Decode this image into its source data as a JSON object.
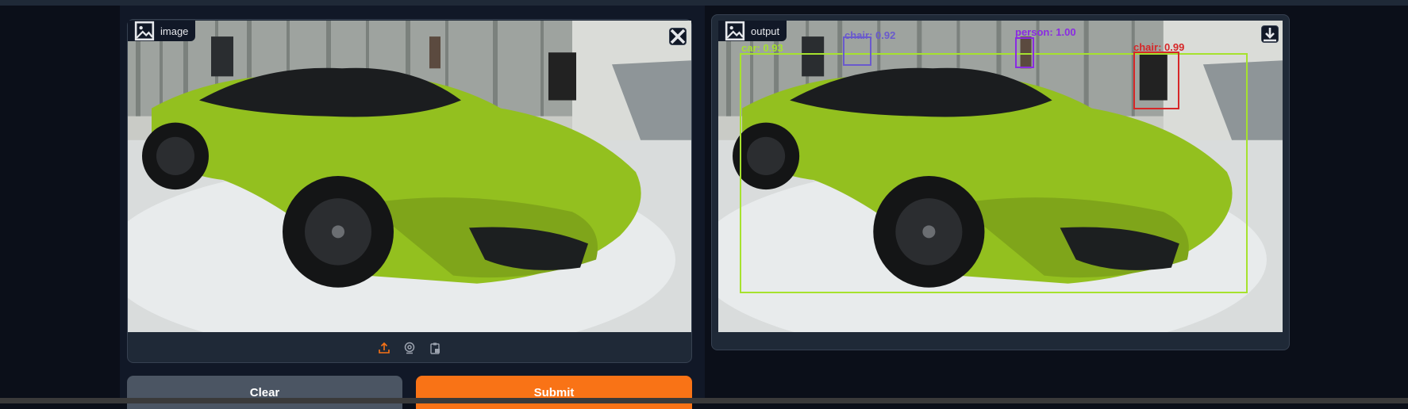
{
  "input_panel": {
    "label": "image",
    "label_icon": "image-icon",
    "close_icon": "close-icon",
    "toolbar_icons": [
      "upload-icon",
      "webcam-icon",
      "clipboard-icon"
    ]
  },
  "output_panel": {
    "label": "output",
    "label_icon": "image-icon",
    "download_icon": "download-icon",
    "detections": [
      {
        "label": "car: 0.93",
        "color": "#a6e22e"
      },
      {
        "label": "chair: 0.92",
        "color": "#6a5acd"
      },
      {
        "label": "person: 1.00",
        "color": "#8a2be2"
      },
      {
        "label": "chair: 0.99",
        "color": "#d62728"
      }
    ]
  },
  "actions": {
    "clear_label": "Clear",
    "submit_label": "Submit"
  },
  "colors": {
    "page_bg": "#0b0f19",
    "panel_bg": "#1f2937",
    "accent_orange": "#f97316",
    "secondary_button": "#4b5563"
  }
}
